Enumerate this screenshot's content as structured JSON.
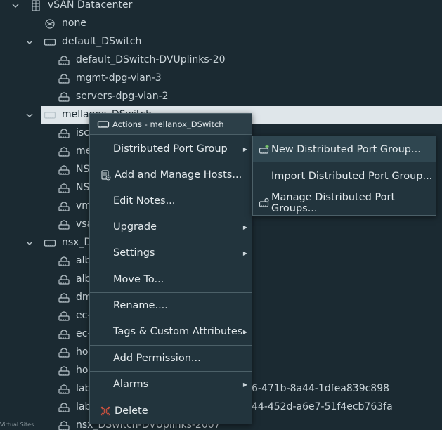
{
  "tree": [
    {
      "name": "vsan-datacenter-row",
      "label": "vSAN Datacenter",
      "icon": "datacenter-icon",
      "chevron": true
    },
    {
      "name": "none-row",
      "label": "none",
      "icon": "globe-network-icon",
      "chevron": false
    },
    {
      "name": "default-dswitch-row",
      "label": "default_DSwitch",
      "icon": "switch-icon",
      "chevron": true
    },
    {
      "name": "dvuplinks-20-row",
      "label": "default_DSwitch-DVUplinks-20",
      "icon": "portgroup-icon",
      "chevron": false
    },
    {
      "name": "mgmt-dpg-row",
      "label": "mgmt-dpg-vlan-3",
      "icon": "portgroup-icon",
      "chevron": false
    },
    {
      "name": "servers-dpg-row",
      "label": "servers-dpg-vlan-2",
      "icon": "portgroup-icon",
      "chevron": false
    },
    {
      "name": "mellanox-dswitch-row",
      "label": "mellanox_DSwitch",
      "icon": "switch-icon",
      "chevron": true,
      "selected": true
    },
    {
      "name": "mellanox-child-1-row",
      "label": "isc",
      "icon": "portgroup-icon",
      "chevron": false
    },
    {
      "name": "mellanox-child-2-row",
      "label": "me",
      "icon": "portgroup-icon",
      "chevron": false
    },
    {
      "name": "mellanox-child-3-row",
      "label": "NS",
      "icon": "portgroup-icon",
      "chevron": false
    },
    {
      "name": "mellanox-child-4-row",
      "label": "NS",
      "icon": "portgroup-icon",
      "chevron": false
    },
    {
      "name": "mellanox-child-5-row",
      "label": "vm",
      "icon": "portgroup-icon",
      "chevron": false
    },
    {
      "name": "mellanox-child-6-row",
      "label": "vsa",
      "icon": "portgroup-icon",
      "chevron": false
    },
    {
      "name": "nsx-dswitch-row",
      "label": "nsx_D",
      "icon": "switch-icon",
      "chevron": true
    },
    {
      "name": "nsx-child-1-row",
      "label": "alb",
      "icon": "portgroup-icon",
      "chevron": false
    },
    {
      "name": "nsx-child-2-row",
      "label": "alb",
      "icon": "portgroup-icon",
      "chevron": false
    },
    {
      "name": "nsx-child-3-row",
      "label": "dm",
      "icon": "portgroup-icon",
      "chevron": false
    },
    {
      "name": "nsx-child-4-row",
      "label": "ec-",
      "icon": "portgroup-icon",
      "chevron": false
    },
    {
      "name": "nsx-child-5-row",
      "label": "ec-",
      "icon": "portgroup-icon",
      "chevron": false
    },
    {
      "name": "nsx-child-6-row",
      "label": "ho",
      "icon": "portgroup-icon",
      "chevron": false
    },
    {
      "name": "nsx-child-7-row",
      "label": "ho",
      "icon": "portgroup-icon",
      "chevron": false
    },
    {
      "name": "nsx-child-8-row",
      "label": "lab",
      "icon": "portgroup-icon",
      "chevron": false
    },
    {
      "name": "nsx-child-9-row",
      "label": "lab",
      "icon": "portgroup-icon",
      "chevron": false
    },
    {
      "name": "nsx-dvuplinks-row",
      "label": "nsx_DSwitch-DVUplinks-2007",
      "icon": "portgroup-icon",
      "chevron": false
    }
  ],
  "tree_overflow": {
    "row8_tail": "6-471b-8a44-1dfea839c898",
    "row9_tail": "44-452d-a6e7-51f4ecb763fa"
  },
  "status_text": "Virtual Sites",
  "context_menu": {
    "header": "Actions - mellanox_DSwitch",
    "items": [
      {
        "label": "Distributed Port Group",
        "submenu": true
      },
      {
        "label": "Add and Manage Hosts...",
        "submenu": false,
        "icon": "add-hosts-icon"
      },
      {
        "label": "Edit Notes...",
        "submenu": false
      },
      {
        "label": "Upgrade",
        "submenu": true
      },
      {
        "label": "Settings",
        "submenu": true
      },
      {
        "label": "Move To...",
        "submenu": false
      },
      {
        "label": "Rename....",
        "submenu": false
      },
      {
        "label": "Tags & Custom Attributes",
        "submenu": true
      },
      {
        "label": "Add Permission...",
        "submenu": false
      },
      {
        "label": "Alarms",
        "submenu": true
      },
      {
        "label": "Delete",
        "submenu": false,
        "icon": "delete-icon"
      }
    ]
  },
  "submenu": {
    "items": [
      {
        "label": "New Distributed Port Group...",
        "icon": "new-portgroup-icon"
      },
      {
        "label": "Import Distributed Port Group..."
      },
      {
        "label": "Manage Distributed Port Groups...",
        "icon": "manage-portgroup-icon"
      }
    ]
  },
  "colors": {
    "background": "#1b2a32",
    "menu_bg": "#22343d",
    "selected_row": "#dfe6ea",
    "delete_red": "#e8563f"
  }
}
